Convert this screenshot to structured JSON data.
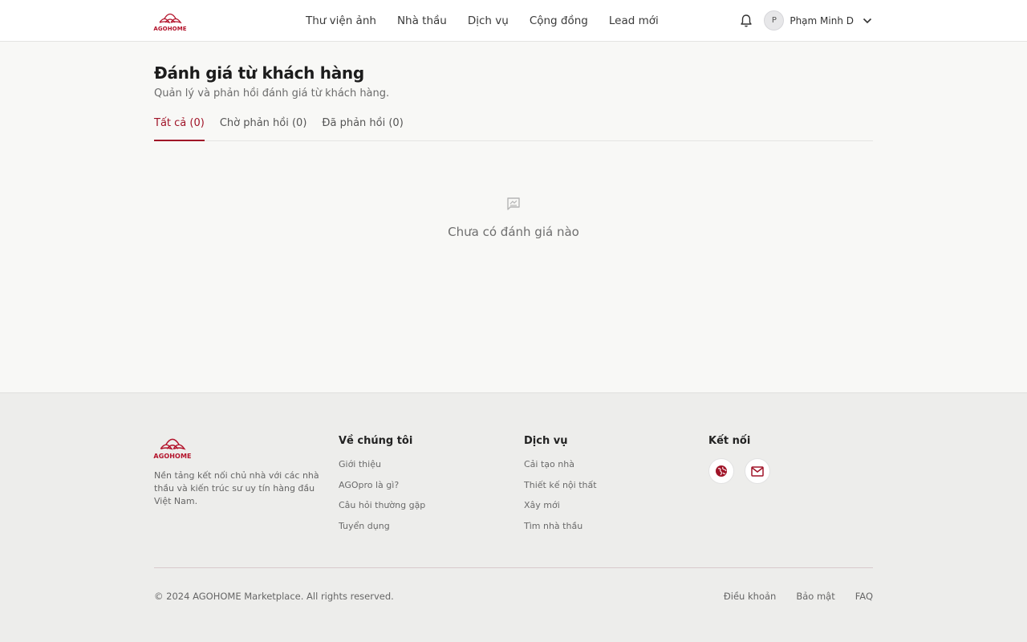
{
  "brand": {
    "name": "AGOHOME",
    "color": "#b3122a"
  },
  "header": {
    "nav": [
      "Thư viện ảnh",
      "Nhà thầu",
      "Dịch vụ",
      "Cộng đồng",
      "Lead mới"
    ],
    "avatar_initial": "P",
    "username": "Phạm Minh D",
    "icons": {
      "notifications": "bell-icon",
      "menu": "chevron-down-icon"
    }
  },
  "page": {
    "title": "Đánh giá từ khách hàng",
    "subtitle": "Quản lý và phản hồi đánh giá từ khách hàng.",
    "tabs": [
      {
        "label": "Tất cả (0)",
        "active": true
      },
      {
        "label": "Chờ phản hồi (0)",
        "active": false
      },
      {
        "label": "Đã phản hồi (0)",
        "active": false
      }
    ],
    "empty_state": {
      "icon": "review-icon",
      "text": "Chưa có đánh giá nào"
    }
  },
  "footer": {
    "description": "Nền tảng kết nối chủ nhà với các nhà thầu và kiến trúc sư uy tín hàng đầu Việt Nam.",
    "columns": [
      {
        "title": "Về chúng tôi",
        "links": [
          "Giới thiệu",
          "AGOpro là gì?",
          "Câu hỏi thường gặp",
          "Tuyển dụng"
        ]
      },
      {
        "title": "Dịch vụ",
        "links": [
          "Cải tạo nhà",
          "Thiết kế nội thất",
          "Xây mới",
          "Tìm nhà thầu"
        ]
      }
    ],
    "connect_title": "Kết nối",
    "social_icons": [
      "globe-icon",
      "mail-icon"
    ],
    "copyright": "© 2024 AGOHOME Marketplace. All rights reserved.",
    "legal": [
      "Điều khoản",
      "Bảo mật",
      "FAQ"
    ]
  },
  "colors": {
    "accent": "#a01428",
    "background": "#f8f8f6",
    "footer_bg": "#ededeb"
  }
}
